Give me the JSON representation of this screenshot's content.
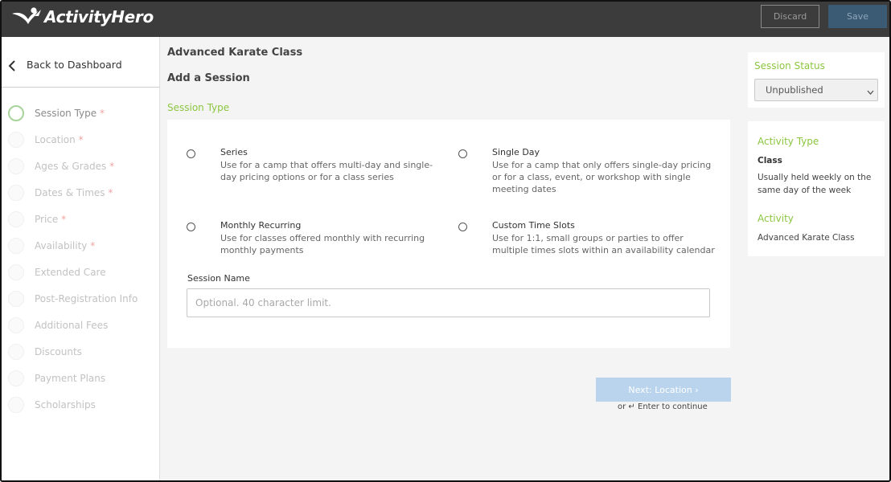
{
  "app": {
    "brand": "ActivityHero"
  },
  "topbar": {
    "discard_label": "Discard",
    "save_label": "Save"
  },
  "sidebar": {
    "back_label": "Back to Dashboard",
    "steps": [
      {
        "label": "Session Type",
        "required": "*",
        "active": true
      },
      {
        "label": "Location",
        "required": "*"
      },
      {
        "label": "Ages & Grades",
        "required": "*"
      },
      {
        "label": "Dates & Times",
        "required": "*"
      },
      {
        "label": "Price",
        "required": "*"
      },
      {
        "label": "Availability",
        "required": "*"
      },
      {
        "label": "Extended Care",
        "required": ""
      },
      {
        "label": "Post-Registration Info",
        "required": ""
      },
      {
        "label": "Additional Fees",
        "required": ""
      },
      {
        "label": "Discounts",
        "required": ""
      },
      {
        "label": "Payment Plans",
        "required": ""
      },
      {
        "label": "Scholarships",
        "required": ""
      }
    ]
  },
  "main": {
    "activity_name": "Advanced Karate Class",
    "page_title": "Add a Session",
    "section_title": "Session Type",
    "options": [
      {
        "title": "Series",
        "desc": "Use for a camp that offers multi-day and single-day pricing options or for a class series"
      },
      {
        "title": "Single Day",
        "desc": "Use for a camp that only offers single-day pricing or for a class, event, or workshop with single meeting dates"
      },
      {
        "title": "Monthly Recurring",
        "desc": "Use for classes offered monthly with recurring monthly payments"
      },
      {
        "title": "Custom Time Slots",
        "desc": "Use for 1:1, small groups or parties to offer multiple times slots within an availability calendar"
      }
    ],
    "session_name_label": "Session Name",
    "session_name_placeholder": "Optional. 40 character limit.",
    "session_name_value": "",
    "next_label": "Next: Location ›",
    "enter_hint_or": "or",
    "enter_hint_text": "Enter to continue"
  },
  "right": {
    "status_title": "Session Status",
    "status_value": "Unpublished",
    "activity_type_title": "Activity Type",
    "activity_type_value": "Class",
    "activity_type_desc": "Usually held weekly on the same day of the week",
    "activity_title": "Activity",
    "activity_value": "Advanced Karate Class"
  },
  "colors": {
    "topbar": "#3c3c3c",
    "accent_green": "#8cc63f",
    "required_red": "#f2a4a4",
    "next_button": "#b9d4ec",
    "save_button": "#3b5a73"
  },
  "icons": {
    "logo": "activityhero-logo-icon",
    "back": "chevron-left-icon",
    "select": "chevron-down-icon",
    "enter": "enter-return-icon"
  }
}
